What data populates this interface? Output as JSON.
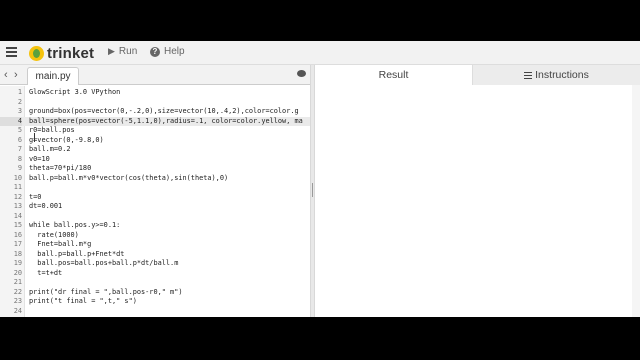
{
  "app": {
    "name": "trinket"
  },
  "toolbar": {
    "run_label": "Run",
    "help_label": "Help"
  },
  "file_tab": {
    "name": "main.py"
  },
  "right_tabs": {
    "result": "Result",
    "instructions": "Instructions"
  },
  "editor": {
    "active_line": 4,
    "lines": [
      {
        "n": "1",
        "code": "GlowScript 3.0 VPython"
      },
      {
        "n": "2",
        "code": ""
      },
      {
        "n": "3",
        "code": "ground=box(pos=vector(0,-.2,0),size=vector(10,.4,2),color=color.g"
      },
      {
        "n": "4",
        "code": "ball=sphere(pos=vector(-5,1.1,0),radius=.1, color=color.yellow, ma"
      },
      {
        "n": "5",
        "code": "r0=ball.pos"
      },
      {
        "n": "6",
        "code": "g=vector(0,-9.8,0)"
      },
      {
        "n": "7",
        "code": "ball.m=0.2"
      },
      {
        "n": "8",
        "code": "v0=10"
      },
      {
        "n": "9",
        "code": "theta=70*pi/180"
      },
      {
        "n": "10",
        "code": "ball.p=ball.m*v0*vector(cos(theta),sin(theta),0)"
      },
      {
        "n": "11",
        "code": ""
      },
      {
        "n": "12",
        "code": "t=0"
      },
      {
        "n": "13",
        "code": "dt=0.001"
      },
      {
        "n": "14",
        "code": ""
      },
      {
        "n": "15",
        "code": "while ball.pos.y>=0.1:"
      },
      {
        "n": "16",
        "code": "  rate(1000)"
      },
      {
        "n": "17",
        "code": "  Fnet=ball.m*g"
      },
      {
        "n": "18",
        "code": "  ball.p=ball.p+Fnet*dt"
      },
      {
        "n": "19",
        "code": "  ball.pos=ball.pos+ball.p*dt/ball.m"
      },
      {
        "n": "20",
        "code": "  t=t+dt"
      },
      {
        "n": "21",
        "code": ""
      },
      {
        "n": "22",
        "code": "print(\"dr final = \",ball.pos-r0,\" m\")"
      },
      {
        "n": "23",
        "code": "print(\"t final = \",t,\" s\")"
      },
      {
        "n": "24",
        "code": ""
      },
      {
        "n": "25",
        "code": ""
      }
    ]
  },
  "icons": {
    "menu": "hamburger-icon",
    "run": "play-icon",
    "help": "question-icon",
    "prev": "chevron-left-icon",
    "next": "chevron-right-icon",
    "chat": "comment-icon",
    "instructions": "list-icon"
  },
  "colors": {
    "logo_yellow": "#f4c20d",
    "logo_green": "#58a13e"
  }
}
